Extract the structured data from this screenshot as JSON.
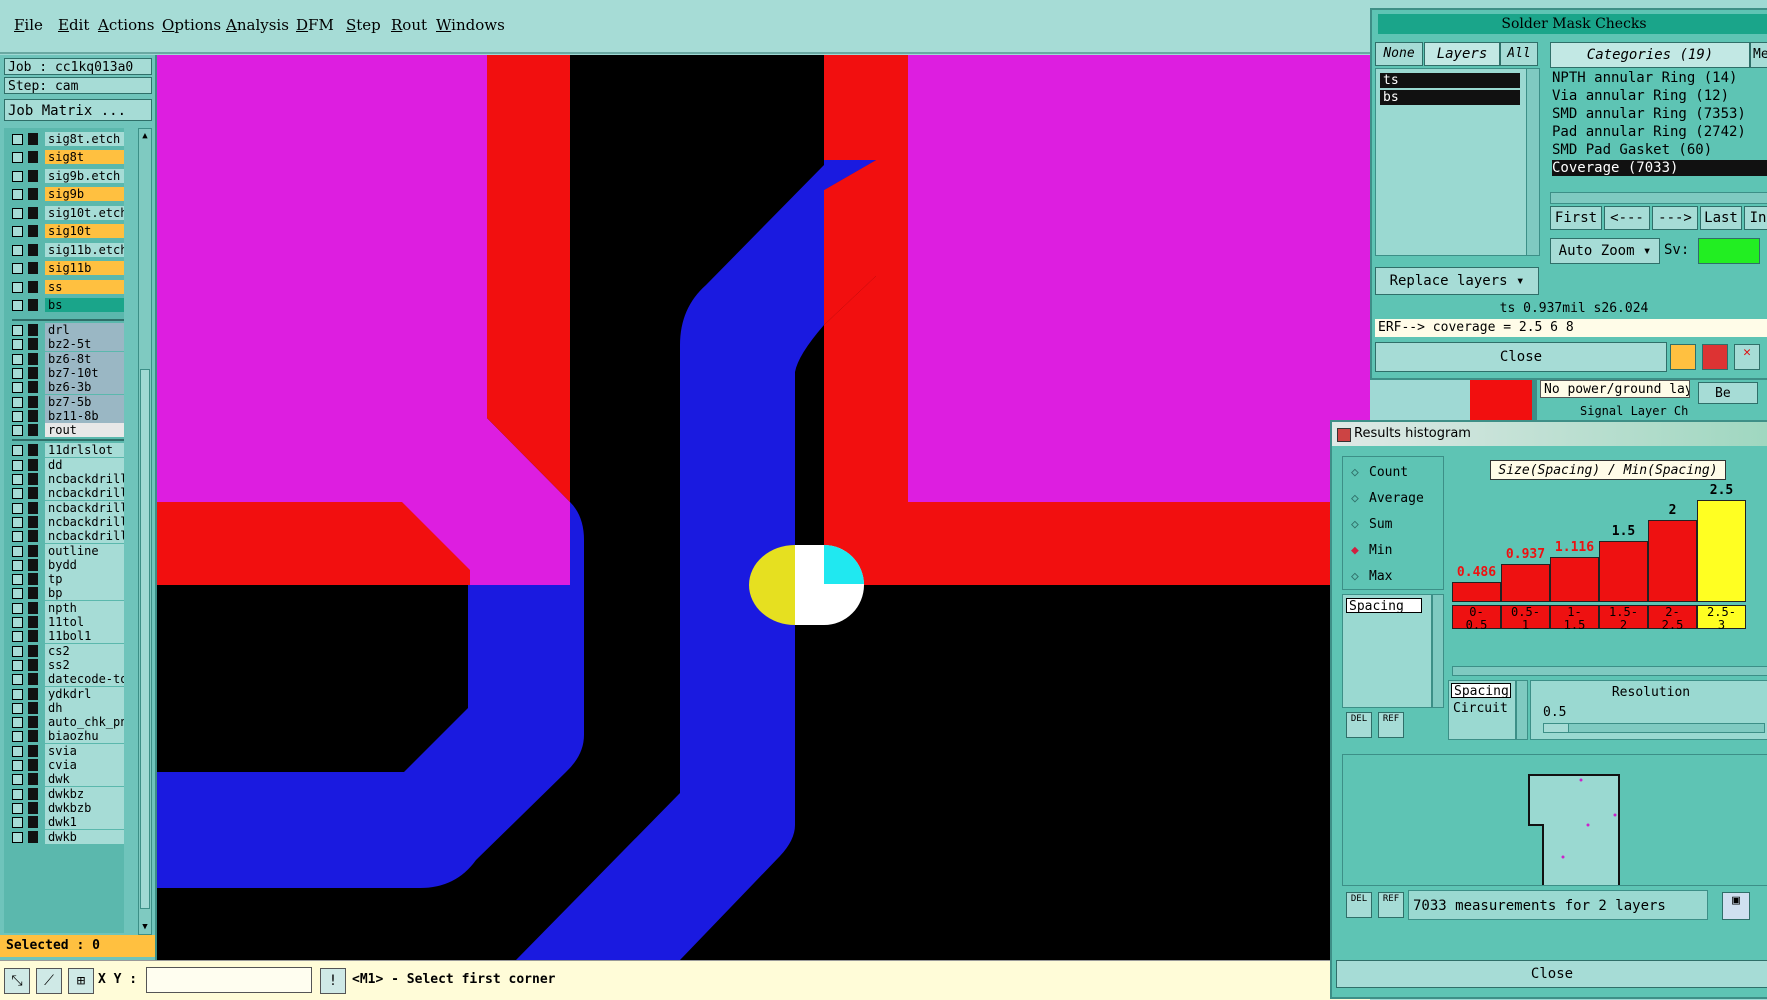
{
  "menu": [
    "File",
    "Edit",
    "Actions",
    "Options",
    "Analysis",
    "DFM",
    "Step",
    "Rout",
    "Windows"
  ],
  "job": {
    "job_label": "Job : cc1kq013a0",
    "step_label": "Step: cam",
    "matrix_button": "Job Matrix ..."
  },
  "layers": [
    {
      "name": "sig8t.etch",
      "bg": "#a6dcd6"
    },
    {
      "name": "sig8t",
      "bg": "#ffc040"
    },
    {
      "name": "sig9b.etch",
      "bg": "#a6dcd6"
    },
    {
      "name": "sig9b",
      "bg": "#ffc040"
    },
    {
      "name": "sig10t.etch",
      "bg": "#a6dcd6"
    },
    {
      "name": "sig10t",
      "bg": "#ffc040"
    },
    {
      "name": "sig11b.etch",
      "bg": "#a6dcd6"
    },
    {
      "name": "sig11b",
      "bg": "#ffc040"
    },
    {
      "name": "ss",
      "bg": "#ffc040"
    },
    {
      "name": "bs",
      "bg": "#1aa58a"
    },
    {
      "name": "drl",
      "bg": "#9ab7c4"
    },
    {
      "name": "bz2-5t",
      "bg": "#9ab7c4"
    },
    {
      "name": "bz6-8t",
      "bg": "#9ab7c4"
    },
    {
      "name": "bz7-10t",
      "bg": "#9ab7c4"
    },
    {
      "name": "bz6-3b",
      "bg": "#9ab7c4"
    },
    {
      "name": "bz7-5b",
      "bg": "#9ab7c4"
    },
    {
      "name": "bz11-8b",
      "bg": "#9ab7c4"
    },
    {
      "name": "rout",
      "bg": "#e8e8e8"
    },
    {
      "name": "11drlslot",
      "bg": "#a6dcd6"
    },
    {
      "name": "dd",
      "bg": "#a6dcd6"
    },
    {
      "name": "ncbackdrill",
      "bg": "#a6dcd6"
    },
    {
      "name": "ncbackdrill",
      "bg": "#a6dcd6"
    },
    {
      "name": "ncbackdrill",
      "bg": "#a6dcd6"
    },
    {
      "name": "ncbackdrill",
      "bg": "#a6dcd6"
    },
    {
      "name": "ncbackdrill",
      "bg": "#a6dcd6"
    },
    {
      "name": "outline",
      "bg": "#a6dcd6"
    },
    {
      "name": "bydd",
      "bg": "#a6dcd6"
    },
    {
      "name": "tp",
      "bg": "#a6dcd6"
    },
    {
      "name": "bp",
      "bg": "#a6dcd6"
    },
    {
      "name": "npth",
      "bg": "#a6dcd6"
    },
    {
      "name": "11tol",
      "bg": "#a6dcd6"
    },
    {
      "name": "11bol1",
      "bg": "#a6dcd6"
    },
    {
      "name": "cs2",
      "bg": "#a6dcd6"
    },
    {
      "name": "ss2",
      "bg": "#a6dcd6"
    },
    {
      "name": "datecode-to",
      "bg": "#a6dcd6"
    },
    {
      "name": "ydkdrl",
      "bg": "#a6dcd6"
    },
    {
      "name": "dh",
      "bg": "#a6dcd6"
    },
    {
      "name": "auto_chk_pn",
      "bg": "#a6dcd6"
    },
    {
      "name": "biaozhu",
      "bg": "#a6dcd6"
    },
    {
      "name": "svia",
      "bg": "#a6dcd6"
    },
    {
      "name": "cvia",
      "bg": "#a6dcd6"
    },
    {
      "name": "dwk",
      "bg": "#a6dcd6"
    },
    {
      "name": "dwkbz",
      "bg": "#a6dcd6"
    },
    {
      "name": "dwkbzb",
      "bg": "#a6dcd6"
    },
    {
      "name": "dwk1",
      "bg": "#a6dcd6"
    },
    {
      "name": "dwkb",
      "bg": "#a6dcd6"
    }
  ],
  "selected_label": "Selected : 0",
  "bottom": {
    "xy_label": "X Y :",
    "xy_value": "",
    "status": "<M1> - Select first corner"
  },
  "solder_mask": {
    "title": "Solder Mask Checks",
    "none_btn": "None",
    "layers_tab": "Layers",
    "all_btn": "All",
    "categories_tab": "Categories (19)",
    "me_tab": "Me",
    "layer_items": [
      "ts",
      "bs"
    ],
    "categories": [
      "NPTH annular Ring (14)",
      "Via annular Ring (12)",
      "SMD annular Ring (7353)",
      "Pad annular Ring (2742)",
      "SMD Pad Gasket (60)",
      "Coverage (7033)"
    ],
    "nav": [
      "First",
      "<---",
      "--->",
      "Last",
      "In"
    ],
    "auto_zoom": "Auto Zoom",
    "sv_label": "Sv:",
    "replace_layers": "Replace layers",
    "info": "ts 0.937mil  s26.024",
    "erf": "ERF--> coverage = 2.5 6 8",
    "close": "Close"
  },
  "behind_text": {
    "power": "No power/ground layer",
    "signal": "Signal Layer Ch",
    "be": "Be"
  },
  "histogram": {
    "title": "Results histogram",
    "modes": [
      "Count",
      "Average",
      "Sum",
      "Min",
      "Max"
    ],
    "selected_mode": "Min",
    "list_items": [
      "Spacing"
    ],
    "chart_title": "Size(Spacing) / Min(Spacing)",
    "types": [
      "Spacing",
      "Circuit"
    ],
    "resolution_label": "Resolution",
    "resolution_value": "0.5",
    "del": "DEL",
    "ref": "REF",
    "summary": "7033 measurements for 2 layers",
    "close": "Close"
  },
  "chart_data": {
    "type": "bar",
    "title": "Size(Spacing) / Min(Spacing)",
    "categories": [
      "0-0.5",
      "0.5-1",
      "1-1.5",
      "1.5-2",
      "2-2.5",
      "2.5-3"
    ],
    "values": [
      0.486,
      0.937,
      1.116,
      1.5,
      2,
      2.5
    ],
    "value_labels": [
      "0.486",
      "0.937",
      "1.116",
      "1.5",
      "2",
      "2.5"
    ],
    "bin_labels": [
      [
        "0-",
        "0.5"
      ],
      [
        "0.5-",
        "1"
      ],
      [
        "1-",
        "1.5"
      ],
      [
        "1.5-",
        "2"
      ],
      [
        "2-",
        "2.5"
      ],
      [
        "2.5-",
        "3"
      ]
    ],
    "colors": [
      "#ee1111",
      "#ee1111",
      "#ee1111",
      "#ee1111",
      "#ee1111",
      "#ffff22"
    ],
    "ylim": [
      0,
      2.6
    ]
  },
  "colors": {
    "magenta": "#dd1ee0",
    "red": "#f20f0f",
    "blue": "#1a1ae0",
    "yellow": "#e6e020",
    "cyan": "#20e8f0"
  }
}
